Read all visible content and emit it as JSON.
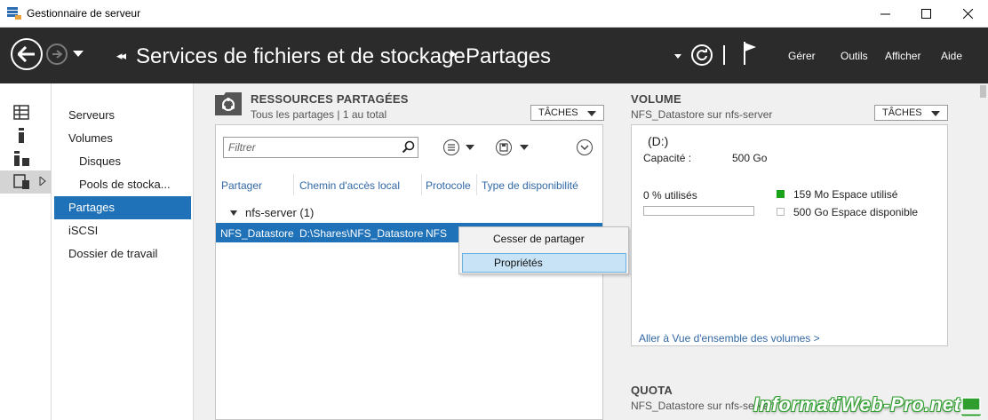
{
  "window": {
    "title": "Gestionnaire de serveur"
  },
  "header": {
    "breadcrumb_root": "Services de fichiers et de stockage",
    "breadcrumb_page": "Partages",
    "menu": [
      "Gérer",
      "Outils",
      "Afficher",
      "Aide"
    ]
  },
  "sidebar": {
    "items": [
      {
        "label": "Serveurs",
        "level": 0
      },
      {
        "label": "Volumes",
        "level": 0
      },
      {
        "label": "Disques",
        "level": 1
      },
      {
        "label": "Pools de stocka...",
        "level": 1
      },
      {
        "label": "Partages",
        "level": 0,
        "selected": true
      },
      {
        "label": "iSCSI",
        "level": 0
      },
      {
        "label": "Dossier de travail",
        "level": 0
      }
    ]
  },
  "shares": {
    "title": "RESSOURCES PARTAGÉES",
    "subtitle": "Tous les partages | 1 au total",
    "tasks_label": "TÂCHES",
    "filter_placeholder": "Filtrer",
    "columns": [
      "Partager",
      "Chemin d'accès local",
      "Protocole",
      "Type de disponibilité"
    ],
    "group_label": "nfs-server (1)",
    "rows": [
      {
        "share": "NFS_Datastore",
        "path": "D:\\Shares\\NFS_Datastore",
        "protocol": "NFS",
        "availability": ""
      }
    ]
  },
  "context_menu": {
    "items": [
      "Cesser de partager",
      "Propriétés"
    ],
    "highlighted": "Propriétés"
  },
  "volume": {
    "title": "VOLUME",
    "subtitle": "NFS_Datastore sur nfs-server",
    "tasks_label": "TÂCHES",
    "drive": "(D:)",
    "capacity_label": "Capacité :",
    "capacity_value": "500 Go",
    "usage_label": "0 % utilisés",
    "usage_fraction": 0.0,
    "used_legend": "159 Mo Espace utilisé",
    "free_legend": "500 Go Espace disponible",
    "link": "Aller à Vue d'ensemble des volumes >"
  },
  "quota": {
    "title": "QUOTA",
    "subtitle": "NFS_Datastore sur nfs-server"
  },
  "watermark": "InformatiWeb-Pro.net",
  "colors": {
    "header_bg": "#2b2b2b",
    "selection": "#1f72b8",
    "link": "#3168a5",
    "used_green": "#1aa31a",
    "context_highlight": "#c8e3f5"
  }
}
